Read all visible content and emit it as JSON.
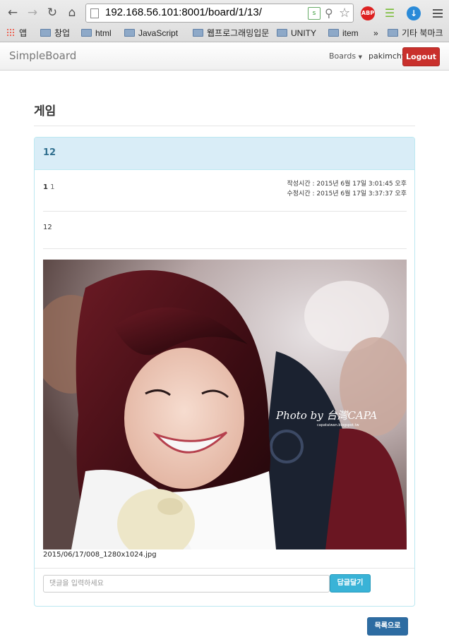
{
  "browser": {
    "url": "192.168.56.101:8001/board/1/13/",
    "bookmarks": [
      {
        "label": "앱",
        "icon": "apps-grid-icon"
      },
      {
        "label": "창업",
        "icon": "folder-icon"
      },
      {
        "label": "html",
        "icon": "folder-icon"
      },
      {
        "label": "JavaScript",
        "icon": "folder-icon"
      },
      {
        "label": "웹프로그래밍입문",
        "icon": "folder-icon"
      },
      {
        "label": "UNITY",
        "icon": "folder-icon"
      },
      {
        "label": "item",
        "icon": "folder-icon"
      },
      {
        "label": "»",
        "icon": "overflow-icon"
      },
      {
        "label": "기타 북마크",
        "icon": "folder-icon"
      }
    ],
    "ext_abp": "ABP"
  },
  "navbar": {
    "brand": "SimpleBoard",
    "boards_label": "Boards",
    "username": "pakimchy",
    "logout_label": "Logout",
    "logout_color": "#c9302c"
  },
  "board": {
    "title": "게임"
  },
  "post": {
    "title": "12",
    "number": "1",
    "author": "1",
    "created": "작성시간 : 2015년 6월 17일 3:01:45 오후",
    "modified": "수정시간 : 2015년 6월 17일 3:37:37 오후",
    "body": "12",
    "attachment_name": "2015/06/17/008_1280x1024.jpg",
    "photo_watermark": "Photo by 台灣CAPA",
    "photo_watermark_sub": "capataiwan.blogspot.tw",
    "panel_color": "#d9edf7"
  },
  "comment": {
    "placeholder": "댓글을 입력하세요",
    "submit_label": "답글달기",
    "submit_color": "#39b3d7"
  },
  "footer": {
    "list_label": "목록으로",
    "list_color": "#2d6ca2"
  }
}
